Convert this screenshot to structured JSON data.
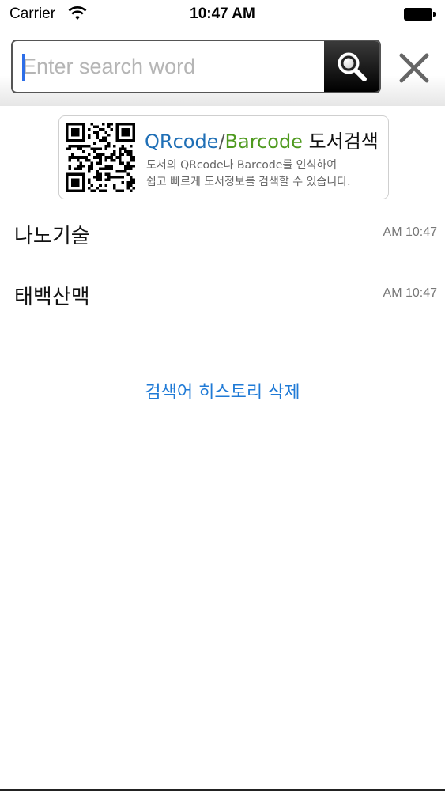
{
  "status_bar": {
    "carrier": "Carrier",
    "time": "10:47 AM"
  },
  "search": {
    "placeholder": "Enter search word",
    "value": ""
  },
  "icons": {
    "search": "search-icon",
    "close": "close-icon",
    "wifi": "wifi-icon",
    "battery": "battery-icon",
    "qr": "qr-code-icon"
  },
  "banner": {
    "title_qr": "QRcode",
    "title_slash": "/",
    "title_barcode": "Barcode",
    "title_rest": " 도서검색",
    "desc_line1": "도서의 QRcode나 Barcode를 인식하여",
    "desc_line2": "쉽고 빠르게 도서정보를 검색할 수 있습니다."
  },
  "history": [
    {
      "word": "나노기술",
      "time": "AM 10:47"
    },
    {
      "word": "태백산맥",
      "time": "AM 10:47"
    }
  ],
  "delete_history_label": "검색어 히스토리 삭제",
  "colors": {
    "accent_blue": "#1f7ad6",
    "qr_blue": "#1f6fb6",
    "barcode_green": "#4f9a1f"
  }
}
